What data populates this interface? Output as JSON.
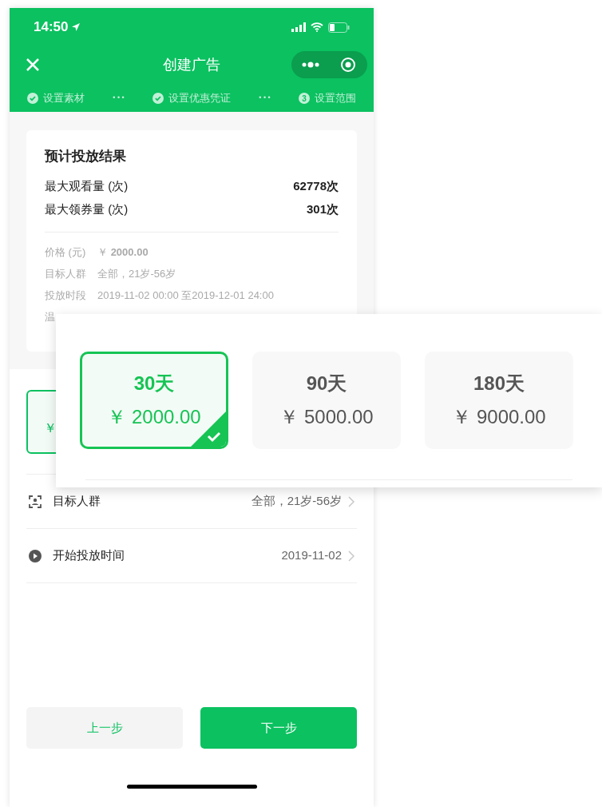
{
  "status_bar": {
    "time": "14:50"
  },
  "nav": {
    "title": "创建广告"
  },
  "steps": [
    {
      "label": "设置素材",
      "done": true
    },
    {
      "label": "设置优惠凭证",
      "done": true
    },
    {
      "label": "设置范围",
      "done": false,
      "number": "3"
    }
  ],
  "step_separator": "• • •",
  "result_card": {
    "title": "预计投放结果",
    "metrics": [
      {
        "label": "最大观看量 (次)",
        "value": "62778次"
      },
      {
        "label": "最大领券量 (次)",
        "value": "301次"
      }
    ],
    "details": [
      {
        "label": "价格 (元)",
        "value": "￥ **2000.00**"
      },
      {
        "label": "目标人群",
        "value": "全部，21岁-56岁"
      },
      {
        "label": "投放时段",
        "value": "2019-11-02 00:00 至2019-12-01 24:00"
      },
      {
        "label": "温"
      }
    ]
  },
  "covered_option": {
    "text": "￥",
    "selected": true
  },
  "settings": [
    {
      "label": "目标人群",
      "value": "全部，21岁-56岁",
      "kind": "target"
    },
    {
      "label": "开始投放时间",
      "value": "2019-11-02",
      "kind": "time"
    }
  ],
  "buttons": [
    {
      "label": "上一步",
      "primary": false
    },
    {
      "label": "下一步",
      "primary": true
    }
  ],
  "duration_options": [
    {
      "days": "30天",
      "price": "￥ 2000.00",
      "selected": true
    },
    {
      "days": "90天",
      "price": "￥ 5000.00",
      "selected": false
    },
    {
      "days": "180天",
      "price": "￥ 9000.00",
      "selected": false
    }
  ]
}
